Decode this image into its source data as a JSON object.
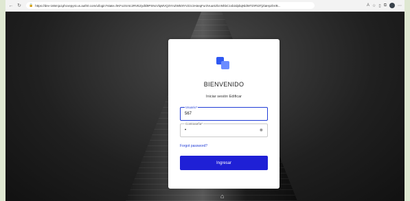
{
  "browser": {
    "url": "https://dev-165mju1phcvepyst.us.auth0.com/u/login?state=hKFo2SAtc2RVEZydkl9PSNcVlqMVQ3YmZWk0tYVZzc3A5eqFur3VuaXZlcnNhbC1sb2dpbqNldWTZIFk3TjZiaHpzbVB..."
  },
  "login": {
    "title": "BIENVENIDO",
    "subtitle": "Iniciar sesión Edificar",
    "username_label": "Usuario*",
    "username_value": "567",
    "password_label": "Contraseña*",
    "password_value": "•",
    "forgot_link": "Forgot password?",
    "submit_label": "Ingresar"
  },
  "colors": {
    "accent": "#1f20d6",
    "focus_border": "#1f3bd6",
    "logo_primary": "#2f58f2",
    "logo_secondary": "#6b8cff"
  },
  "icons": [
    "back-icon",
    "refresh-icon",
    "lock-icon",
    "eye-icon",
    "favorite-icon",
    "settings-icon",
    "more-icon"
  ]
}
